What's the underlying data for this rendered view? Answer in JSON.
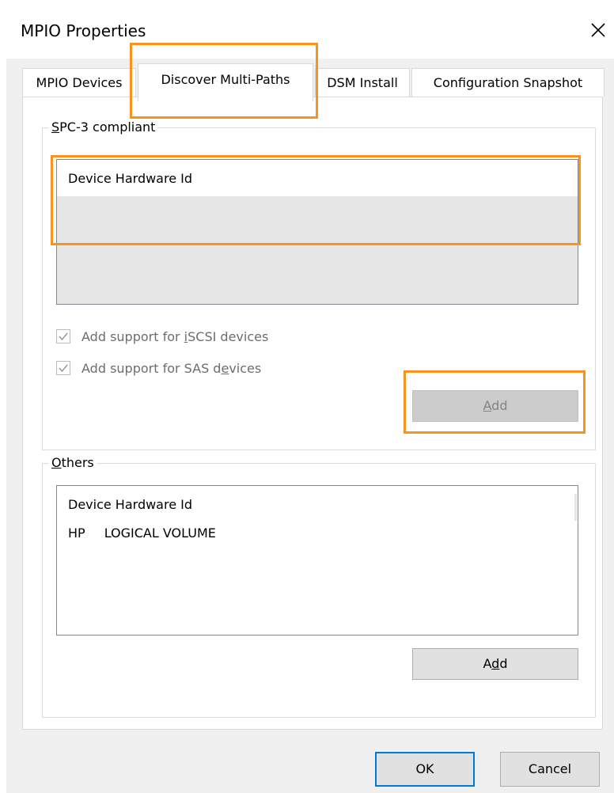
{
  "window": {
    "title": "MPIO Properties",
    "close_glyph": "×"
  },
  "tabs": [
    {
      "label": "MPIO Devices",
      "selected": false
    },
    {
      "label": "Discover Multi-Paths",
      "selected": true
    },
    {
      "label": "DSM Install",
      "selected": false
    },
    {
      "label": "Configuration Snapshot",
      "selected": false
    }
  ],
  "spc3": {
    "legend_a": "S",
    "legend_b": "PC-3 compliant",
    "column_header": "Device Hardware Id",
    "rows": [],
    "iscsi_a": "Add support for ",
    "iscsi_b": "i",
    "iscsi_c": "SCSI devices",
    "iscsi_checked": true,
    "sas_a": "Add support for SAS d",
    "sas_b": "e",
    "sas_c": "vices",
    "sas_checked": true,
    "add_a": "A",
    "add_b": "dd",
    "add_enabled": false
  },
  "others": {
    "legend_a": "O",
    "legend_b": "thers",
    "column_header": "Device Hardware Id",
    "rows": [
      {
        "vendor": "HP",
        "product": "LOGICAL VOLUME"
      }
    ],
    "add_a": "A",
    "add_b": "d",
    "add_c": "d",
    "add_enabled": true
  },
  "footer": {
    "ok_label": "OK",
    "cancel_label": "Cancel"
  },
  "colors": {
    "highlight": "#f7941d",
    "default_button_border": "#0078d7",
    "disabled_text": "#838383"
  },
  "icons": {
    "close": "close-icon",
    "checkmark": "checkmark-icon"
  }
}
